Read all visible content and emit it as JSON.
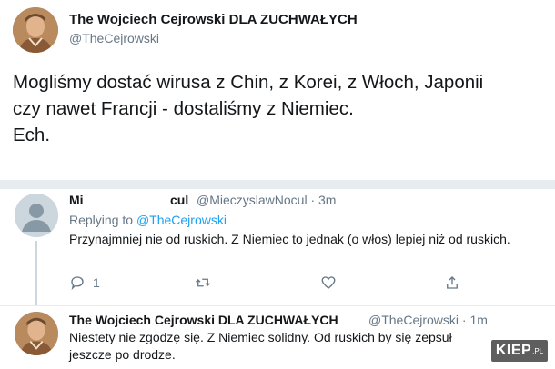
{
  "main_tweet": {
    "display_name": "The Wojciech Cejrowski DLA ZUCHWAŁYCH",
    "handle": "@TheCejrowski",
    "text": "Mogliśmy dostać wirusa z Chin, z Korei, z Włoch, Japonii\nczy nawet Francji - dostaliśmy z Niemiec.\nEch."
  },
  "reply": {
    "name_start": "Mi",
    "name_end": "cul",
    "handle_time": "@MieczyslawNocul · 3m",
    "replying_prefix": "Replying to",
    "replying_mention": "@TheCejrowski",
    "text": "Przynajmniej nie od ruskich. Z Niemiec to jednak (o włos) lepiej niż od ruskich.",
    "actions": {
      "reply_count": "1",
      "reply_icon": "comment-icon",
      "retweet_icon": "retweet-icon",
      "like_icon": "heart-icon",
      "share_icon": "share-icon"
    }
  },
  "response": {
    "display_name": "The Wojciech Cejrowski DLA ZUCHWAŁYCH",
    "handle_time": "@TheCejrowski · 1m",
    "text": "Niestety nie zgodzę się. Z Niemiec solidny. Od ruskich by się zepsuł jeszcze po drodze."
  },
  "watermark": {
    "text": "KIEP",
    "suffix": ".PL"
  },
  "colors": {
    "link": "#1da1f2",
    "muted": "#657786",
    "text": "#14171a",
    "divider": "#e6ecf0"
  }
}
